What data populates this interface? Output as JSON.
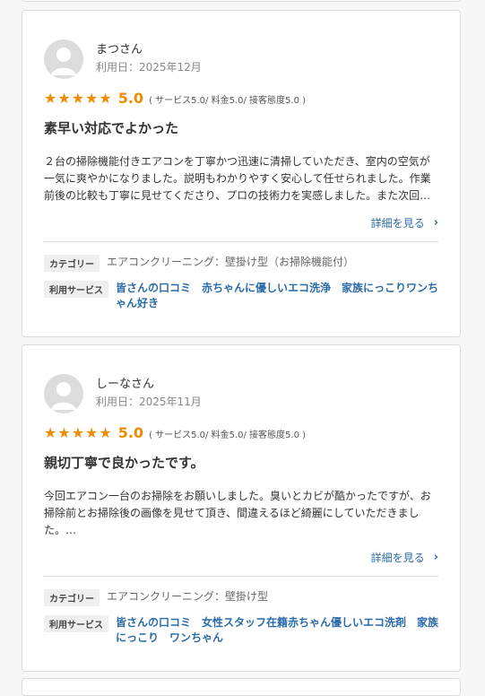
{
  "reviews": [
    {
      "user_name": "まつさん",
      "usage_date": "利用日：2025年12月",
      "stars": "★★★★★",
      "score": "5.0",
      "sub_scores": "( サービス5.0/ 料金5.0/ 接客態度5.0 )",
      "title": "素早い対応でよかった",
      "body": "２台の掃除機能付きエアコンを丁寧かつ迅速に清掃していただき、室内の空気が一気に爽やかになりました。説明もわかりやすく安心して任せられました。作業前後の比較も丁寧に見せてくださり、プロの技術力を実感しました。また次回…",
      "detail_label": "詳細を見る",
      "category_label": "カテゴリー",
      "category_value": "エアコンクリーニング：壁掛け型（お掃除機能付）",
      "services_label": "利用サービス",
      "services_value": "皆さんの口コミ　赤ちゃんに優しいエコ洗浄　家族にっこりワンちゃん好き"
    },
    {
      "user_name": "しーなさん",
      "usage_date": "利用日：2025年11月",
      "stars": "★★★★★",
      "score": "5.0",
      "sub_scores": "( サービス5.0/ 料金5.0/ 接客態度5.0 )",
      "title": "親切丁寧で良かったです。",
      "body": "今回エアコン一台のお掃除をお願いしました。臭いとカビが酷かったですが、お掃除前とお掃除後の画像を見せて頂き、間違えるほど綺麗にしていただきました。…",
      "detail_label": "詳細を見る",
      "category_label": "カテゴリー",
      "category_value": "エアコンクリーニング：壁掛け型",
      "services_label": "利用サービス",
      "services_value": "皆さんの口コミ　女性スタッフ在籍赤ちゃん優しいエコ洗剤　家族にっこり　ワンちゃん"
    }
  ],
  "colors": {
    "accent_star": "#f08c00",
    "link": "#2b6ca8",
    "border": "#dcdcdc"
  }
}
